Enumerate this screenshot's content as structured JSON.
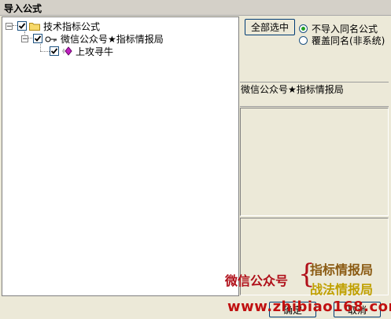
{
  "window": {
    "title": "导入公式"
  },
  "tree": {
    "root": {
      "label": "技术指标公式",
      "checked": true,
      "expanded": true
    },
    "child": {
      "label": "微信公众号★指标情报局",
      "checked": true,
      "expanded": true
    },
    "leaf": {
      "label": "上攻寻牛",
      "checked": true
    }
  },
  "controls": {
    "select_all_label": "全部选中",
    "radio_no_import": "不导入同名公式",
    "radio_overwrite": "覆盖同名(非系统)",
    "selected_option": "不导入同名公式"
  },
  "info": {
    "formula_name": "微信公众号★指标情报局"
  },
  "footer": {
    "ok_label": "确定",
    "cancel_label": "取消"
  },
  "watermark": {
    "left": "微信公众号",
    "right1": "指标情报局",
    "right2": "战法情报局",
    "url": "www.zhibiao168.com"
  },
  "colors": {
    "accent": "#21a121",
    "watermark_red": "#b0101a"
  }
}
